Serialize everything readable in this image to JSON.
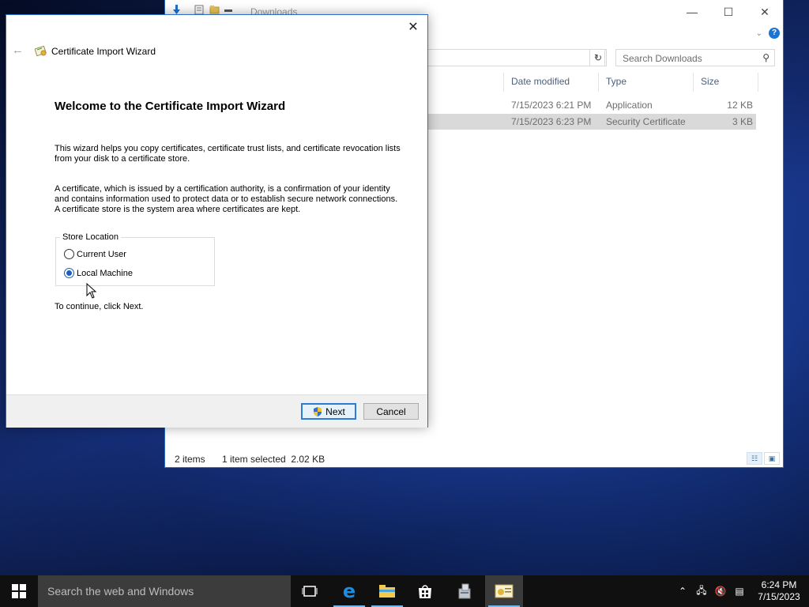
{
  "explorer": {
    "title": "Downloads",
    "search_placeholder": "Search Downloads",
    "columns": {
      "date_modified": "Date modified",
      "type": "Type",
      "size": "Size"
    },
    "files": [
      {
        "date": "7/15/2023 6:21 PM",
        "type": "Application",
        "size": "12 KB",
        "selected": false
      },
      {
        "date": "7/15/2023 6:23 PM",
        "type": "Security Certificate",
        "size": "3 KB",
        "selected": true
      }
    ],
    "status": {
      "items": "2 items",
      "selection": "1 item selected  2.02 KB"
    }
  },
  "wizard": {
    "title": "Certificate Import Wizard",
    "heading": "Welcome to the Certificate Import Wizard",
    "para1": "This wizard helps you copy certificates, certificate trust lists, and certificate revocation lists from your disk to a certificate store.",
    "para2": "A certificate, which is issued by a certification authority, is a confirmation of your identity and contains information used to protect data or to establish secure network connections. A certificate store is the system area where certificates are kept.",
    "store_location": {
      "legend": "Store Location",
      "options": [
        {
          "label": "Current User",
          "checked": false
        },
        {
          "label": "Local Machine",
          "checked": true
        }
      ]
    },
    "continue_text": "To continue, click Next.",
    "next_label": "Next",
    "cancel_label": "Cancel"
  },
  "taskbar": {
    "search_placeholder": "Search the web and Windows",
    "clock_time": "6:24 PM",
    "clock_date": "7/15/2023"
  },
  "colors": {
    "accent": "#2b6cc4",
    "selection": "#d9d9d9",
    "taskbar": "#101010"
  }
}
